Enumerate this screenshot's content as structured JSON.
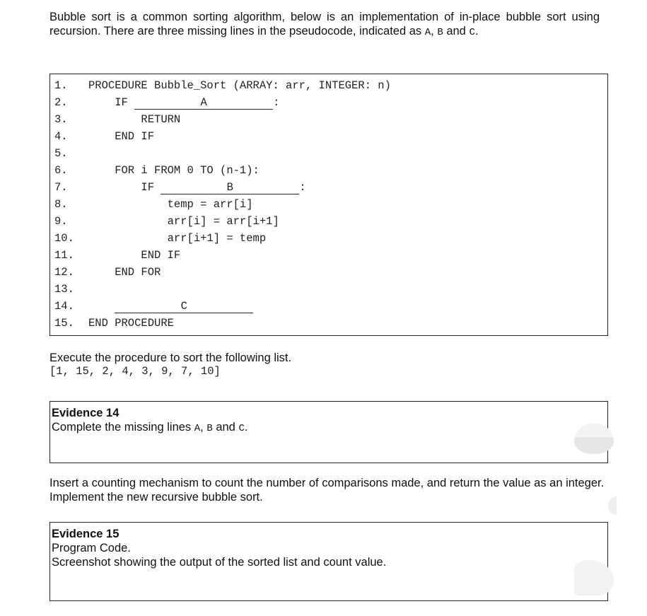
{
  "intro": {
    "text_before": "Bubble sort is a common sorting algorithm, below is an implementation of in-place bubble sort using recursion. There are three missing lines in the pseudocode, indicated as ",
    "label_a": "A",
    "sep1": ", ",
    "label_b": "B",
    "sep2": " and ",
    "label_c": "C",
    "text_after": "."
  },
  "code": {
    "lines": [
      {
        "num": "1.",
        "text": "PROCEDURE Bubble_Sort (ARRAY: arr, INTEGER: n)"
      },
      {
        "num": "2.",
        "prefix": "    IF ",
        "blank": "A",
        "suffix": ":"
      },
      {
        "num": "3.",
        "text": "        RETURN"
      },
      {
        "num": "4.",
        "text": "    END IF"
      },
      {
        "num": "5.",
        "text": ""
      },
      {
        "num": "6.",
        "text": "    FOR i FROM 0 TO (n-1):"
      },
      {
        "num": "7.",
        "prefix": "        IF ",
        "blank": "B",
        "suffix": ":"
      },
      {
        "num": "8.",
        "text": "            temp = arr[i]"
      },
      {
        "num": "9.",
        "text": "            arr[i] = arr[i+1]"
      },
      {
        "num": "10.",
        "text": "            arr[i+1] = temp"
      },
      {
        "num": "11.",
        "text": "        END IF"
      },
      {
        "num": "12.",
        "text": "    END FOR"
      },
      {
        "num": "13.",
        "text": ""
      },
      {
        "num": "14.",
        "prefix": "    ",
        "blank": "C",
        "suffix": ""
      },
      {
        "num": "15.",
        "text": "END PROCEDURE"
      }
    ]
  },
  "execute": {
    "instruction": "Execute the procedure to sort the following list.",
    "list": "[1, 15, 2, 4, 3, 9, 7, 10]"
  },
  "evidence14": {
    "title": "Evidence 14",
    "text_before": "Complete the missing lines ",
    "label_a": "A",
    "sep1": ", ",
    "label_b": "B",
    "sep2": " and ",
    "label_c": "C",
    "text_after": "."
  },
  "counting": {
    "text": "Insert a counting mechanism to count the number of comparisons made, and return the value as an integer. Implement the new recursive bubble sort."
  },
  "evidence15": {
    "title": "Evidence 15",
    "line1": "Program Code.",
    "line2": "Screenshot showing the output of the sorted list and count value."
  }
}
